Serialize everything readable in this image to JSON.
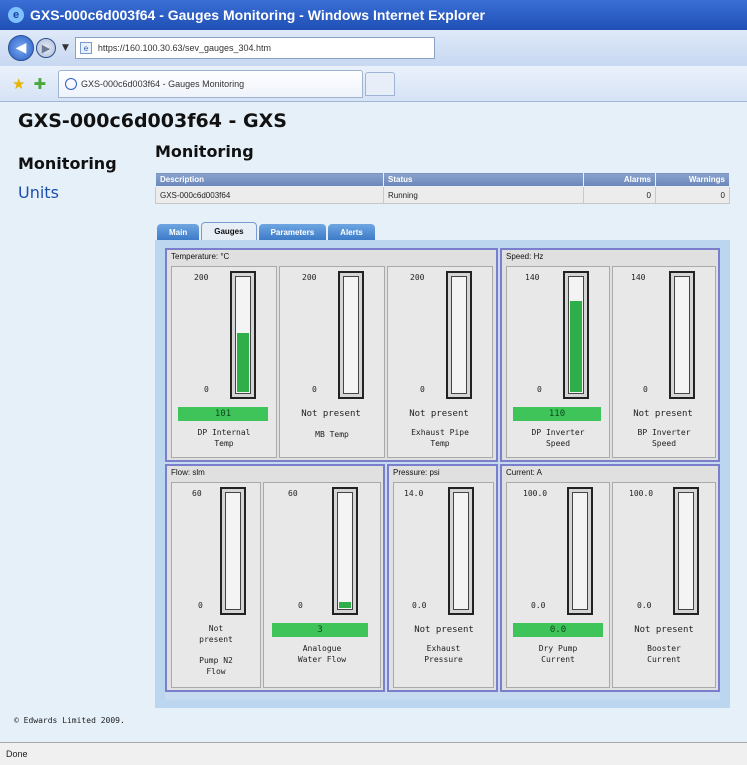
{
  "window": {
    "title": "GXS-000c6d003f64 - Gauges Monitoring - Windows Internet Explorer"
  },
  "address": {
    "url": "https://160.100.30.63/sev_gauges_304.htm"
  },
  "tab": {
    "label": "GXS-000c6d003f64 - Gauges Monitoring"
  },
  "page": {
    "title": "GXS-000c6d003f64 - GXS",
    "section_title": "Monitoring"
  },
  "nav": {
    "monitoring": "Monitoring",
    "units": "Units"
  },
  "units_table": {
    "headers": [
      "Description",
      "Status",
      "Alarms",
      "Warnings"
    ],
    "rows": [
      [
        "GXS-000c6d003f64",
        "Running",
        "0",
        "0"
      ]
    ]
  },
  "tabs": [
    "Main",
    "Gauges",
    "Parameters",
    "Alerts"
  ],
  "groups": [
    {
      "label": "Temperature: °C",
      "gauges": [
        {
          "max": "200",
          "min": "0",
          "value": "101",
          "name_line1": "DP Internal",
          "name_line2": "Temp",
          "level": 0.505,
          "present": true
        },
        {
          "max": "200",
          "min": "0",
          "value": "Not present",
          "name_line1": "MB Temp",
          "name_line2": "",
          "level": 0,
          "present": false
        },
        {
          "max": "200",
          "min": "0",
          "value": "Not present",
          "name_line1": "Exhaust Pipe",
          "name_line2": "Temp",
          "level": 0,
          "present": false
        }
      ]
    },
    {
      "label": "Speed: Hz",
      "gauges": [
        {
          "max": "140",
          "min": "0",
          "value": "110",
          "name_line1": "DP Inverter",
          "name_line2": "Speed",
          "level": 0.786,
          "present": true
        },
        {
          "max": "140",
          "min": "0",
          "value": "Not present",
          "name_line1": "BP Inverter",
          "name_line2": "Speed",
          "level": 0,
          "present": false
        }
      ]
    },
    {
      "label": "Flow: slm",
      "gauges": [
        {
          "max": "60",
          "min": "0",
          "value_line1": "Not",
          "value_line2": "present",
          "name_line1": "Pump N2",
          "name_line2": "Flow",
          "level": 0,
          "present": false
        },
        {
          "max": "60",
          "min": "0",
          "value": "3",
          "name_line1": "Analogue",
          "name_line2": "Water Flow",
          "level": 0.05,
          "present": true
        }
      ]
    },
    {
      "label": "Pressure: psi",
      "gauges": [
        {
          "max": "14.0",
          "min": "0.0",
          "value": "Not present",
          "name_line1": "Exhaust",
          "name_line2": "Pressure",
          "level": 0,
          "present": false
        }
      ]
    },
    {
      "label": "Current: A",
      "gauges": [
        {
          "max": "100.0",
          "min": "0.0",
          "value": "0.0",
          "name_line1": "Dry Pump",
          "name_line2": "Current",
          "level": 0,
          "present": true
        },
        {
          "max": "100.0",
          "min": "0.0",
          "value": "Not present",
          "name_line1": "Booster",
          "name_line2": "Current",
          "level": 0,
          "present": false
        }
      ]
    }
  ],
  "footer": {
    "text": "© Edwards Limited 2009."
  },
  "status": {
    "text": "Done"
  },
  "colors": {
    "gauge_fill": "#2fae4a",
    "value_ok": "#3fc45a",
    "group_border": "#7a7ecb",
    "header_bar": "#6b86b9"
  }
}
